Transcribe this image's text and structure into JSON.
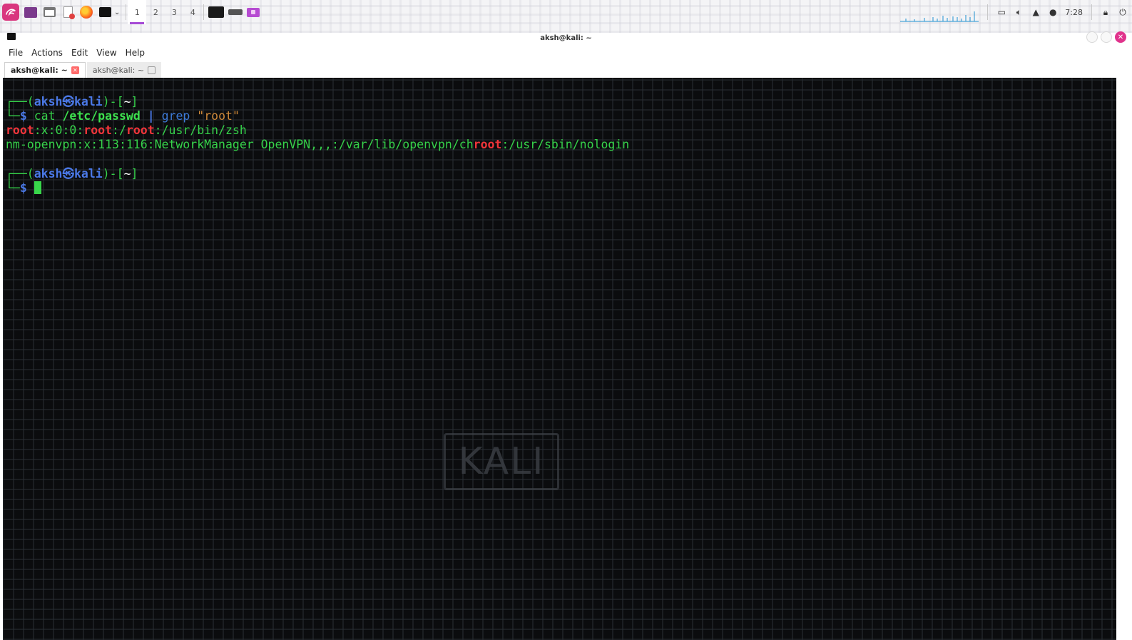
{
  "panel": {
    "app_icons": [
      "kali-menu-icon",
      "terminal-purple-icon",
      "file-manager-icon",
      "text-editor-icon",
      "firefox-icon",
      "terminal-icon"
    ],
    "workspaces": [
      "1",
      "2",
      "3",
      "4"
    ],
    "active_workspace": "1",
    "clock": "7:28",
    "accent_color": "#a64bd6"
  },
  "window": {
    "title": "aksh@kali: ~"
  },
  "menubar": {
    "items": [
      "File",
      "Actions",
      "Edit",
      "View",
      "Help"
    ]
  },
  "tabs": [
    {
      "label": "aksh@kali: ~",
      "active": true
    },
    {
      "label": "aksh@kali: ~",
      "active": false
    }
  ],
  "terminal": {
    "prompt1": {
      "corner": "┌──(",
      "user": "aksh",
      "at": "㉿",
      "host": "kali",
      "close": ")-[",
      "dir": "~",
      "end": "]"
    },
    "cmd1": {
      "corner": "└─",
      "dollar": "$",
      "cmd": "cat",
      "path": "/etc/passwd",
      "pipe": "|",
      "grep": "grep",
      "arg": "\"root\""
    },
    "out1": {
      "m1": "root",
      "s1": ":x:0:0:",
      "m2": "root",
      "s2": ":/",
      "m3": "root",
      "s3": ":/usr/bin/zsh"
    },
    "out2": {
      "s1": "nm-openvpn:x:113:116:NetworkManager OpenVPN,,,:/var/lib/openvpn/ch",
      "m1": "root",
      "s2": ":/usr/sbin/nologin"
    },
    "prompt2": {
      "corner": "┌──(",
      "user": "aksh",
      "at": "㉿",
      "host": "kali",
      "close": ")-[",
      "dir": "~",
      "end": "]"
    },
    "cmd2": {
      "corner": "└─",
      "dollar": "$"
    },
    "watermark": "KALI"
  }
}
